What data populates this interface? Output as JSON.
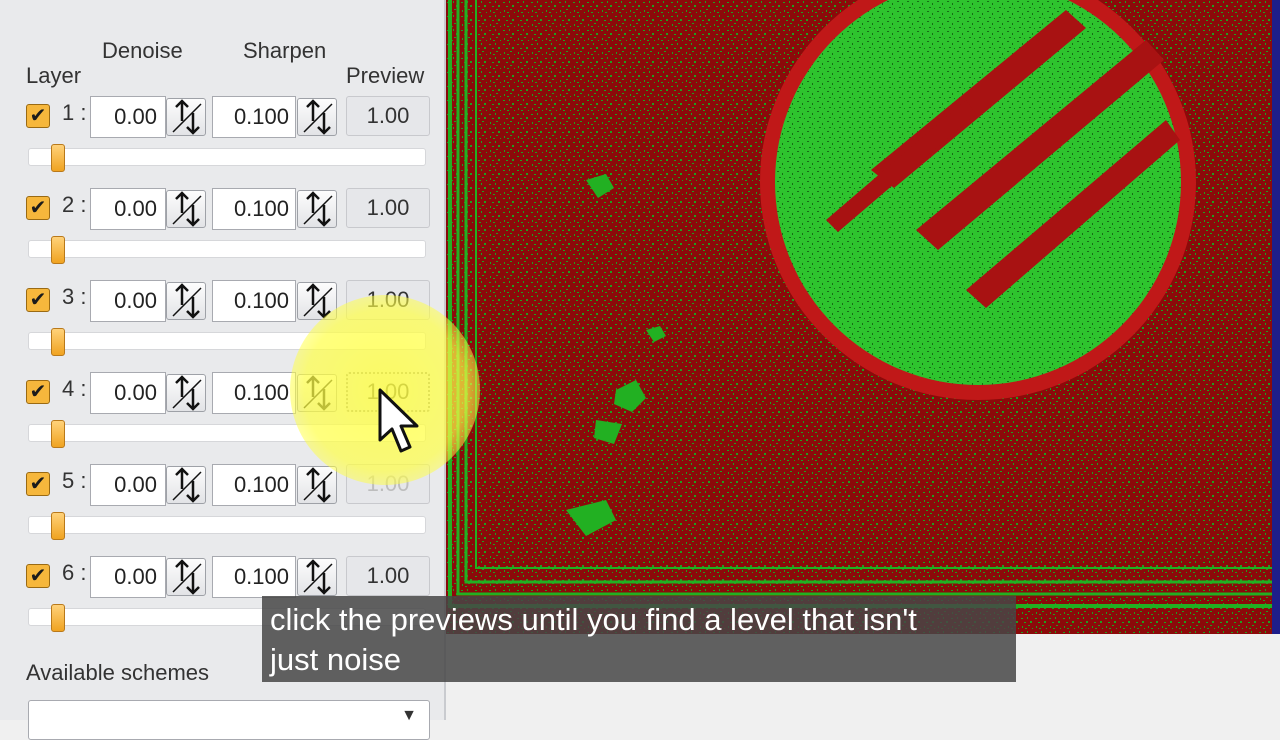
{
  "headers": {
    "layer": "Layer",
    "denoise": "Denoise",
    "sharpen": "Sharpen",
    "preview": "Preview"
  },
  "layers": [
    {
      "checked": true,
      "label": "1 :",
      "denoise": "0.00",
      "sharpen": "0.100",
      "preview": "1.00"
    },
    {
      "checked": true,
      "label": "2 :",
      "denoise": "0.00",
      "sharpen": "0.100",
      "preview": "1.00"
    },
    {
      "checked": true,
      "label": "3 :",
      "denoise": "0.00",
      "sharpen": "0.100",
      "preview": "1.00"
    },
    {
      "checked": true,
      "label": "4 :",
      "denoise": "0.00",
      "sharpen": "0.100",
      "preview": "1.00"
    },
    {
      "checked": true,
      "label": "5 :",
      "denoise": "0.00",
      "sharpen": "0.100",
      "preview": "1.00"
    },
    {
      "checked": true,
      "label": "6 :",
      "denoise": "0.00",
      "sharpen": "0.100",
      "preview": "1.00"
    }
  ],
  "schemes": {
    "label": "Available schemes",
    "selected": ""
  },
  "caption": {
    "line1": "click the previews until you find a level that isn't",
    "line2": "just noise"
  },
  "icons": {
    "checkbox": "check-icon",
    "spinner": "up-down-arrows-icon",
    "dropdown": "chevron-down-icon",
    "cursor": "mouse-pointer-icon"
  },
  "colors": {
    "accent": "#f6b73c",
    "preview_red": "#8b0a0a",
    "preview_green": "#22b022",
    "highlight": "#ffff46",
    "caption_bg": "#464646"
  }
}
